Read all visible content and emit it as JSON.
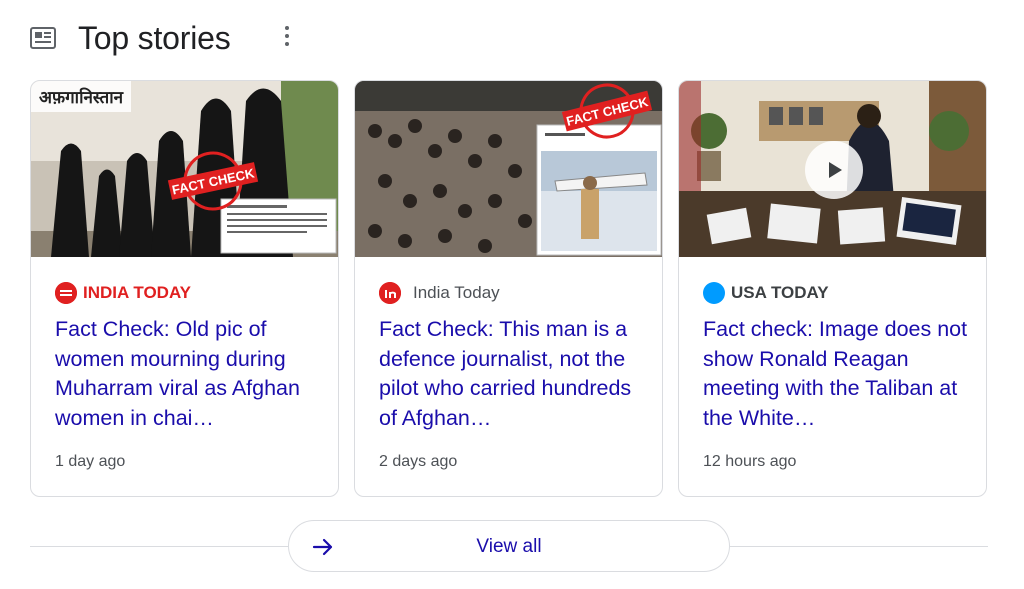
{
  "header": {
    "title": "Top stories",
    "icon": "newspaper-icon",
    "more_icon": "more-vert-icon"
  },
  "colors": {
    "link": "#1a0dab",
    "meta": "#4d5156",
    "border": "#dadce0",
    "india_today_red": "#e02020",
    "usa_today_blue": "#009bff"
  },
  "cards": [
    {
      "image_text": "अफ़गानिस्तान",
      "image_stamp": "FACT CHECK",
      "source": "INDIA TODAY",
      "headline": "Fact Check: Old pic of women mourning during Muharram viral as Afghan women in chai…",
      "time": "1 day ago"
    },
    {
      "image_stamp": "FACT CHECK",
      "source": "India Today",
      "headline": "Fact Check: This man is a defence journalist, not the pilot who carried hundreds of Afghan…",
      "time": "2 days ago"
    },
    {
      "source": "USA TODAY",
      "headline": "Fact check: Image does not show Ronald Reagan meeting with the Taliban at the White…",
      "time": "12 hours ago",
      "play_icon": "play-icon"
    }
  ],
  "view_all": {
    "label": "View all",
    "icon": "arrow-right-icon"
  }
}
